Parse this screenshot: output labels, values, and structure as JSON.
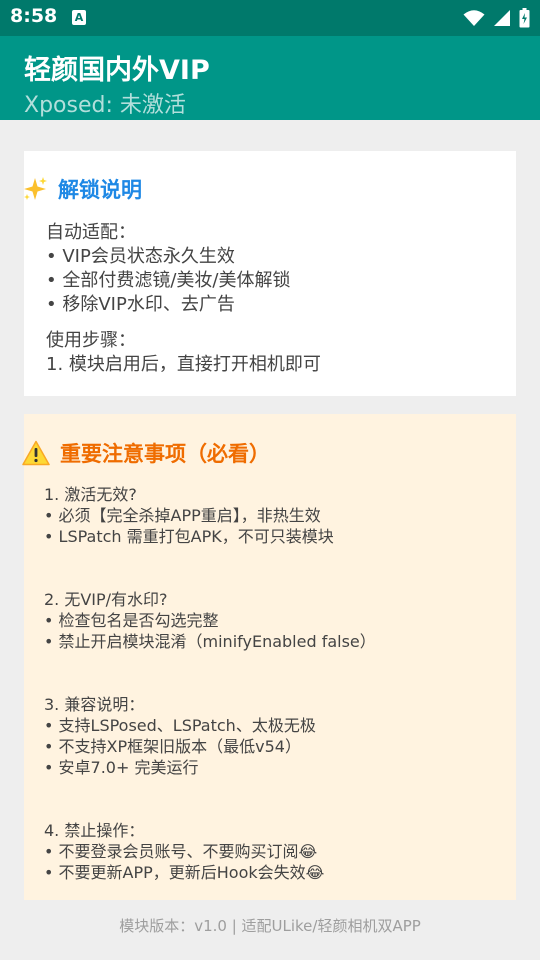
{
  "status_bar": {
    "time": "8:58",
    "notification_letter": "A",
    "icons": [
      "wifi-icon",
      "signal-icon",
      "battery-icon"
    ]
  },
  "app_bar": {
    "title": "轻颜国内外VIP",
    "subtitle": "Xposed: 未激活"
  },
  "unlock_card": {
    "icon": "sparkles-icon",
    "title": "解锁说明",
    "lines": [
      "自动适配：",
      "• VIP会员状态永久生效",
      "• 全部付费滤镜/美妆/美体解锁",
      "• 移除VIP水印、去广告",
      "使用步骤：",
      "1. 模块启用后，直接打开相机即可"
    ]
  },
  "notes_card": {
    "icon": "warning-icon",
    "title": "重要注意事项（必看）",
    "lines": [
      "1. 激活无效?",
      "• 必须【完全杀掉APP重启】，非热生效",
      "• LSPatch 需重打包APK，不可只装模块",
      "2. 无VIP/有水印?",
      "• 检查包名是否勾选完整",
      "• 禁止开启模块混淆（minifyEnabled false）",
      "3. 兼容说明：",
      "• 支持LSPosed、LSPatch、太极无极",
      "• 不支持XP框架旧版本（最低v54）",
      "• 安卓7.0+ 完美运行",
      "4. 禁止操作：",
      "• 不要登录会员账号、不要购买订阅😂",
      "• 不要更新APP，更新后Hook会失效😂"
    ]
  },
  "footer": {
    "text": "模块版本：v1.0 | 适配ULike/轻颜相机双APP"
  },
  "colors": {
    "status_bar": "#00796b",
    "app_bar": "#009688",
    "unlock_title": "#1e88e5",
    "notes_title": "#ef6c00",
    "notes_background": "#fff3e0"
  }
}
